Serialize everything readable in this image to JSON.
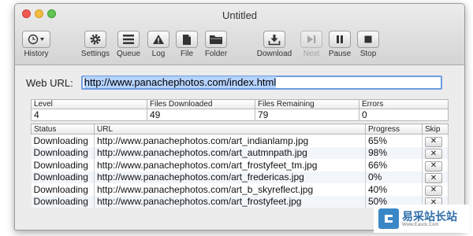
{
  "window": {
    "title": "Untitled"
  },
  "toolbar": {
    "items": [
      {
        "label": "History"
      },
      {
        "label": "Settings"
      },
      {
        "label": "Queue"
      },
      {
        "label": "Log"
      },
      {
        "label": "File"
      },
      {
        "label": "Folder"
      },
      {
        "label": "Download"
      },
      {
        "label": "Next"
      },
      {
        "label": "Pause"
      },
      {
        "label": "Stop"
      }
    ]
  },
  "url": {
    "label": "Web URL:",
    "value": "http://www.panachephotos.com/index.html"
  },
  "stats": {
    "headers": [
      "Level",
      "Files Downloaded",
      "Files Remaining",
      "Errors"
    ],
    "values": [
      "4",
      "49",
      "79",
      "0"
    ]
  },
  "downloads": {
    "headers": [
      "Status",
      "URL",
      "Progress",
      "Skip"
    ],
    "skip_glyph": "✕",
    "rows": [
      {
        "status": "Downloading",
        "url": "http://www.panachephotos.com/art_indianlamp.jpg",
        "progress": "65%"
      },
      {
        "status": "Downloading",
        "url": "http://www.panachephotos.com/art_autmnpath.jpg",
        "progress": "98%"
      },
      {
        "status": "Downloading",
        "url": "http://www.panachephotos.com/art_frostyfeet_tm.jpg",
        "progress": "66%"
      },
      {
        "status": "Downloading",
        "url": "http://www.panachephotos.com/art_fredericas.jpg",
        "progress": "0%"
      },
      {
        "status": "Downloading",
        "url": "http://www.panachephotos.com/art_b_skyreflect.jpg",
        "progress": "40%"
      },
      {
        "status": "Downloading",
        "url": "http://www.panachephotos.com/art_frostyfeet.jpg",
        "progress": "50%"
      }
    ]
  },
  "watermark": {
    "title": "易采站长站",
    "subtitle": "Www.Easck.Com"
  }
}
